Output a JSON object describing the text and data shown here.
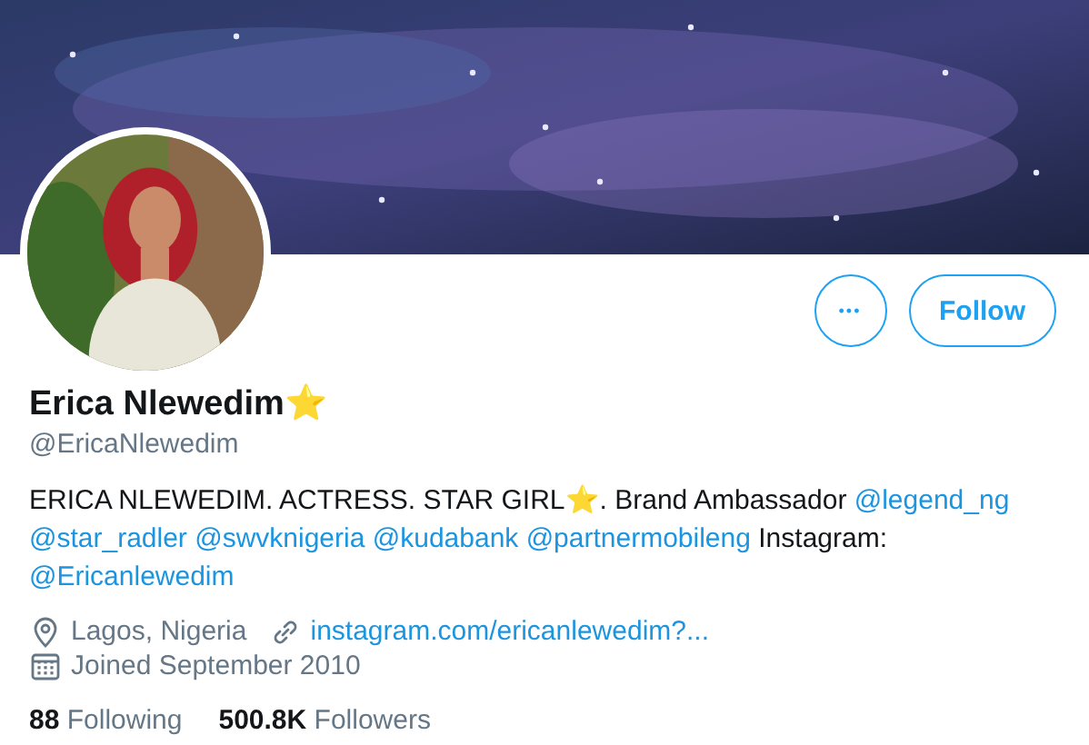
{
  "actions": {
    "more": "•••",
    "follow": "Follow"
  },
  "profile": {
    "name": "Erica Nlewedim",
    "name_emoji": "⭐",
    "handle": "@EricaNlewedim"
  },
  "bio": [
    {
      "kind": "text",
      "text": "ERICA NLEWEDIM. ACTRESS. STAR GIRL"
    },
    {
      "kind": "emoji",
      "text": "⭐"
    },
    {
      "kind": "text",
      "text": ". Brand Ambassador "
    },
    {
      "kind": "mention",
      "text": "@legend_ng"
    },
    {
      "kind": "space"
    },
    {
      "kind": "mention",
      "text": "@star_radler"
    },
    {
      "kind": "space"
    },
    {
      "kind": "mention",
      "text": "@swvknigeria"
    },
    {
      "kind": "space"
    },
    {
      "kind": "mention",
      "text": "@kudabank"
    },
    {
      "kind": "space"
    },
    {
      "kind": "mention",
      "text": "@partnermobileng"
    },
    {
      "kind": "text",
      "text": " Instagram: "
    },
    {
      "kind": "mention",
      "text": "@Ericanlewedim"
    }
  ],
  "meta": [
    {
      "kind": "location",
      "text": "Lagos, Nigeria"
    },
    {
      "kind": "link",
      "text": "instagram.com/ericanlewedim?..."
    },
    {
      "kind": "joined",
      "text": "Joined September 2010"
    }
  ],
  "stats": [
    {
      "count": "88",
      "label": "Following"
    },
    {
      "count": "500.8K",
      "label": "Followers"
    }
  ]
}
